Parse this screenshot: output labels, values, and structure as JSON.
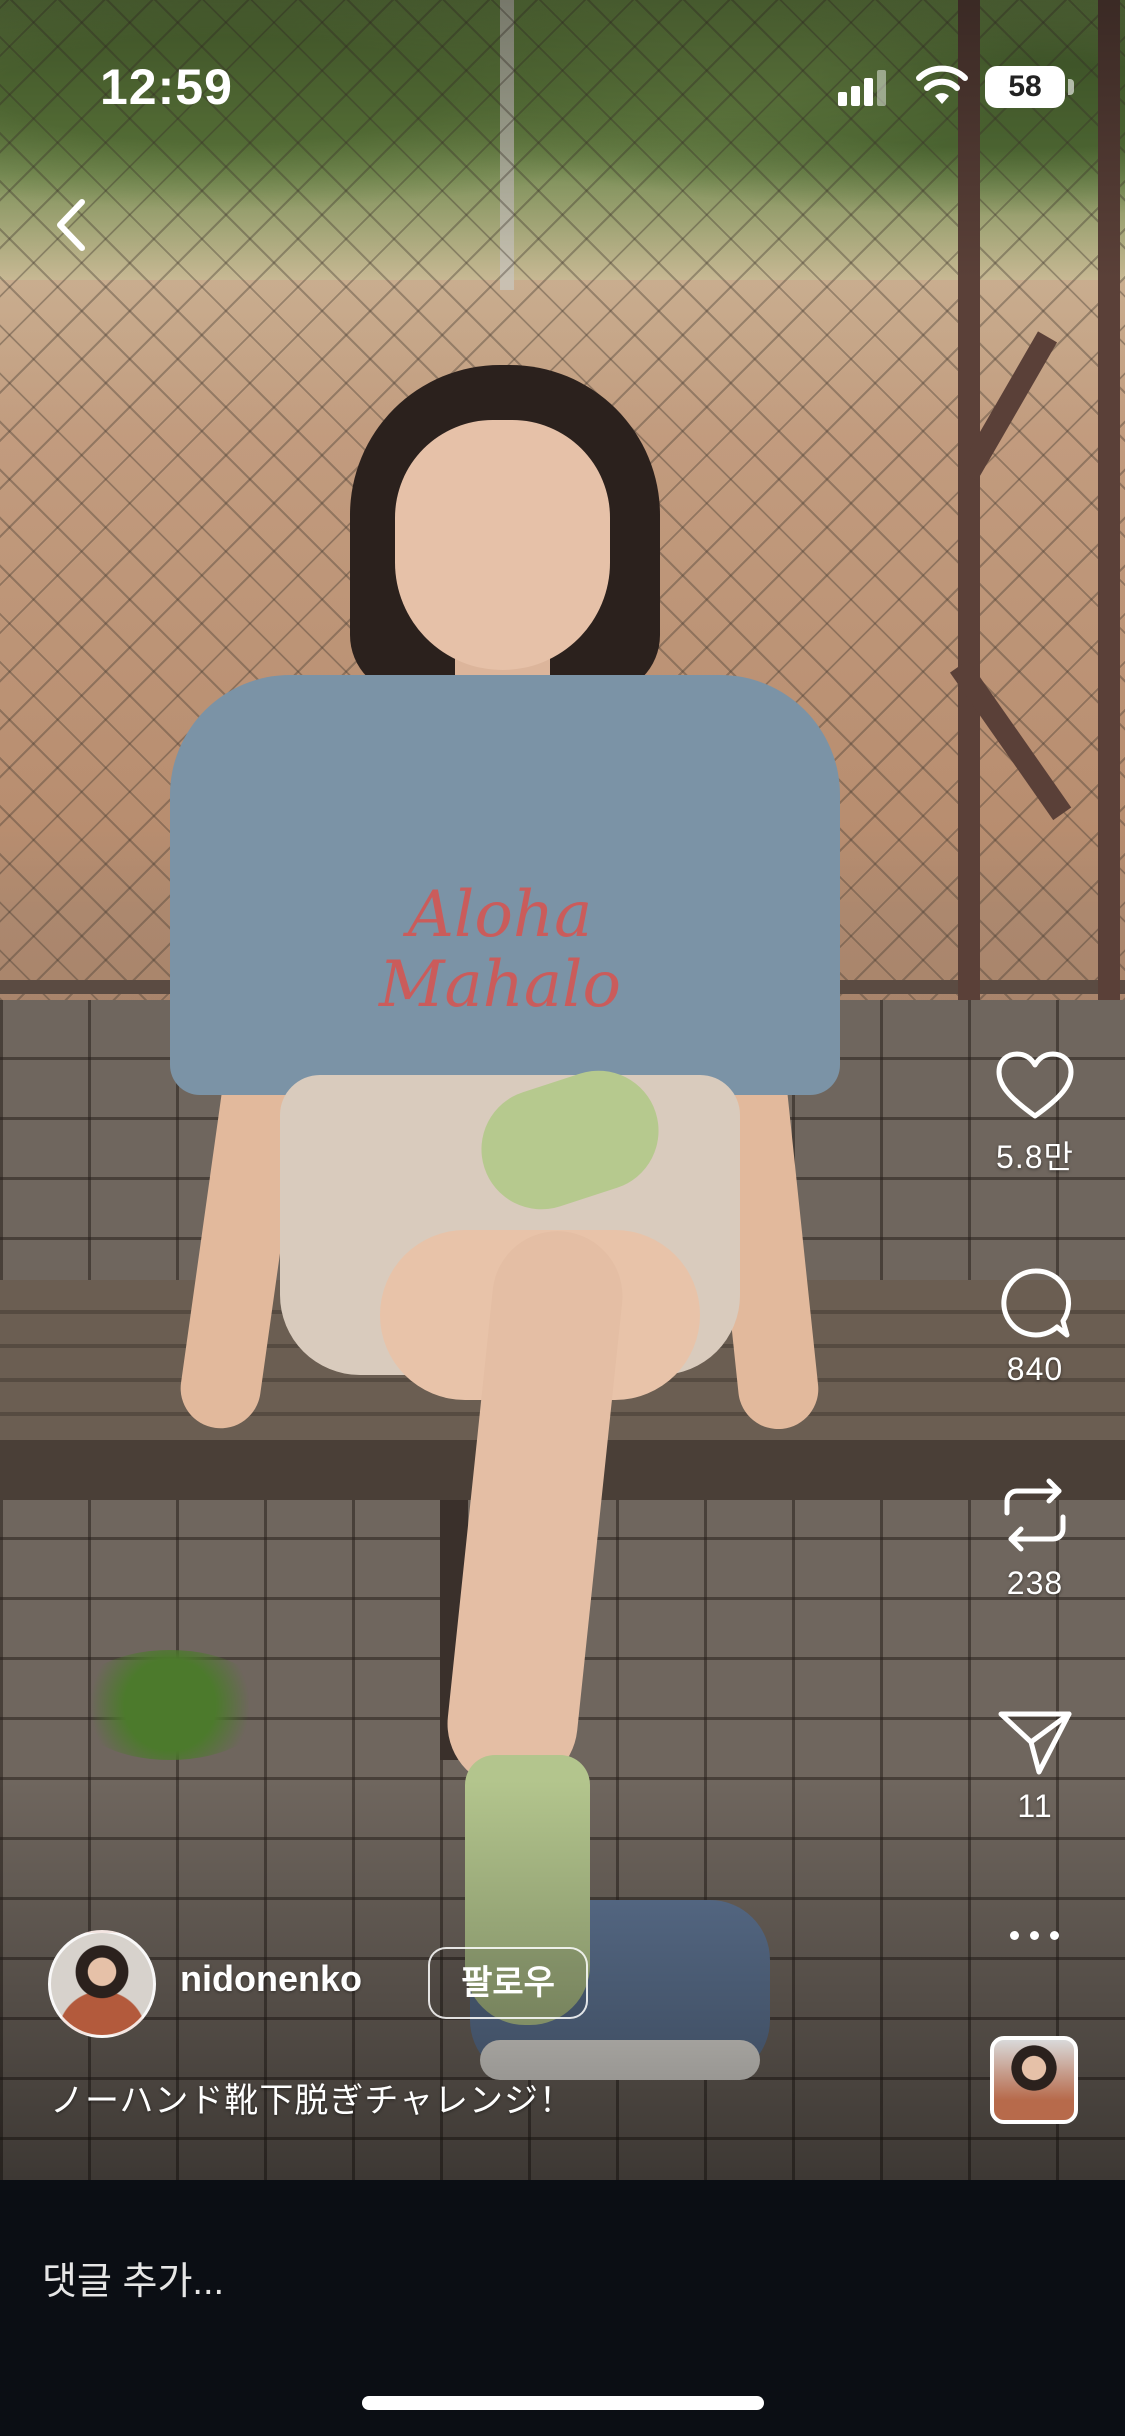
{
  "status_bar": {
    "time": "12:59",
    "battery": "58"
  },
  "post": {
    "author": {
      "username": "nidonenko",
      "follow_label": "팔로우"
    },
    "caption": "ノーハンド靴下脱ぎチャレンジ！",
    "shirt_print": "Aloha Mahalo"
  },
  "actions": {
    "likes": "5.8만",
    "comments": "840",
    "reposts": "238",
    "shares": "11"
  },
  "comment_bar": {
    "placeholder": "댓글 추가..."
  },
  "icons": [
    "back-icon",
    "signal-icon",
    "wifi-icon",
    "battery-icon",
    "heart-icon",
    "comment-icon",
    "repost-icon",
    "send-icon",
    "more-icon"
  ],
  "colors": {
    "background": "#0b0e14",
    "text": "#ffffff"
  }
}
